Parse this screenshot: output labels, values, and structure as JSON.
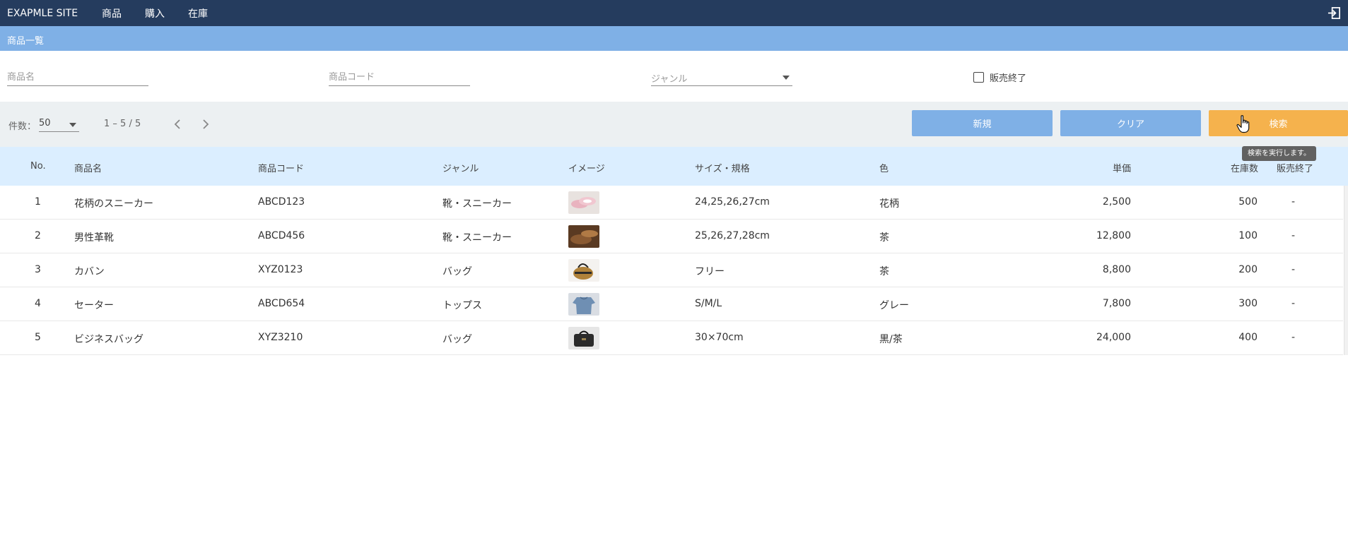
{
  "header": {
    "brand": "EXAPMLE SITE",
    "nav": [
      "商品",
      "購入",
      "在庫"
    ]
  },
  "page_title": "商品一覧",
  "search": {
    "name_placeholder": "商品名",
    "code_placeholder": "商品コード",
    "genre_placeholder": "ジャンル",
    "discontinued_label": "販売終了"
  },
  "toolbar": {
    "perpage_label": "件数：",
    "perpage_value": "50",
    "range": "1 – 5 / 5",
    "new_label": "新規",
    "clear_label": "クリア",
    "search_label": "検索",
    "tooltip": "検索を実行します。"
  },
  "table": {
    "columns": [
      "No.",
      "商品名",
      "商品コード",
      "ジャンル",
      "イメージ",
      "サイズ・規格",
      "色",
      "単価",
      "在庫数",
      "販売終了"
    ],
    "rows": [
      {
        "no": "1",
        "name": "花柄のスニーカー",
        "code": "ABCD123",
        "genre": "靴・スニーカー",
        "size": "24,25,26,27cm",
        "color": "花柄",
        "price": "2,500",
        "stock": "500",
        "discontinued": "-"
      },
      {
        "no": "2",
        "name": "男性革靴",
        "code": "ABCD456",
        "genre": "靴・スニーカー",
        "size": "25,26,27,28cm",
        "color": "茶",
        "price": "12,800",
        "stock": "100",
        "discontinued": "-"
      },
      {
        "no": "3",
        "name": "カバン",
        "code": "XYZ0123",
        "genre": "バッグ",
        "size": "フリー",
        "color": "茶",
        "price": "8,800",
        "stock": "200",
        "discontinued": "-"
      },
      {
        "no": "4",
        "name": "セーター",
        "code": "ABCD654",
        "genre": "トップス",
        "size": "S/M/L",
        "color": "グレー",
        "price": "7,800",
        "stock": "300",
        "discontinued": "-"
      },
      {
        "no": "5",
        "name": "ビジネスバッグ",
        "code": "XYZ3210",
        "genre": "バッグ",
        "size": "30×70cm",
        "color": "黒/茶",
        "price": "24,000",
        "stock": "400",
        "discontinued": "-"
      }
    ]
  },
  "colors": {
    "topbar": "#253c5e",
    "titlebar": "#7fb0e6",
    "primary_button": "#7fb0e6",
    "search_button": "#f5b24d",
    "table_header": "#dbeeff"
  },
  "icons": [
    "logout-icon",
    "chevron-left-icon",
    "chevron-right-icon",
    "dropdown-caret-icon",
    "hand-cursor-icon"
  ]
}
